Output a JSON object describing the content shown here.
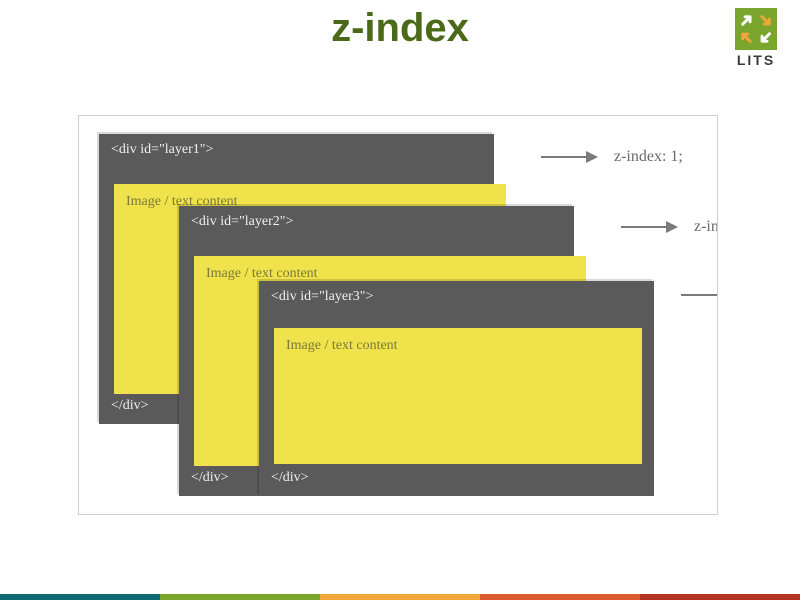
{
  "title": "z-index",
  "logo": {
    "text": "LITS"
  },
  "layers": [
    {
      "open": "<div id=\"layer1\">",
      "content": "Image / text content",
      "close": "</div>",
      "annotation": "z-index: 1;"
    },
    {
      "open": "<div id=\"layer2\">",
      "content": "Image / text content",
      "close": "</div>",
      "annotation": "z-inde"
    },
    {
      "open": "<div id=\"layer3\">",
      "content": "Image / text content",
      "close": "</div>",
      "annotation": ""
    }
  ],
  "colors": {
    "title": "#4a6a1a",
    "layer_bg": "#5a5a5a",
    "content_bg": "#f0e24a",
    "footer": [
      "#0f6b73",
      "#7aa62e",
      "#f3a63a",
      "#d95b2f",
      "#b33324"
    ]
  }
}
